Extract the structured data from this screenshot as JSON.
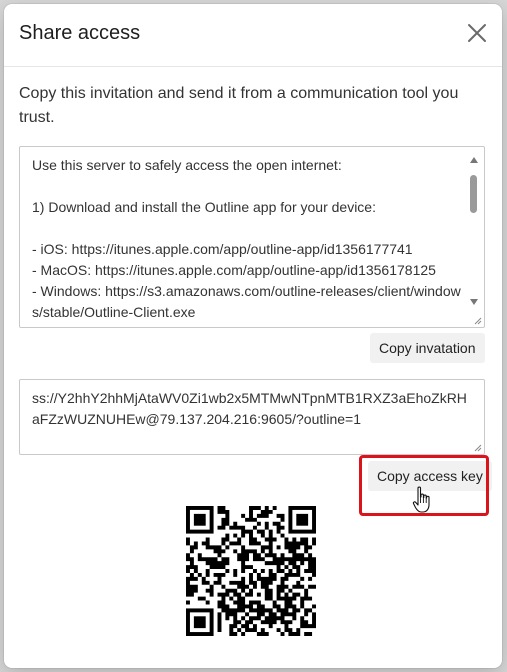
{
  "dialog": {
    "title": "Share access",
    "close_icon": "close-icon",
    "description": "Copy this invitation and send it from a communication tool you trust."
  },
  "invitation": {
    "text": "Use this server to safely access the open internet:\n\n1) Download and install the Outline app for your device:\n\n- iOS: https://itunes.apple.com/app/outline-app/id1356177741\n- MacOS: https://itunes.apple.com/app/outline-app/id1356178125\n- Windows: https://s3.amazonaws.com/outline-releases/client/windows/stable/Outline-Client.exe",
    "copy_label": "Copy invatation"
  },
  "access_key": {
    "value": "ss://Y2hhY2hhMjAtaWV0Zi1wb2x5MTMwNTpnMTB1RXZ3aEhoZkRHaFZzWUZNUHEw@79.137.204.216:9605/?outline=1",
    "copy_label": "Copy access key"
  },
  "colors": {
    "highlight": "#d9141b",
    "button_bg": "#f1f1f1"
  },
  "icons": {
    "close": "close-icon",
    "cursor": "hand-pointer-icon",
    "qr": "qr-code-icon"
  }
}
